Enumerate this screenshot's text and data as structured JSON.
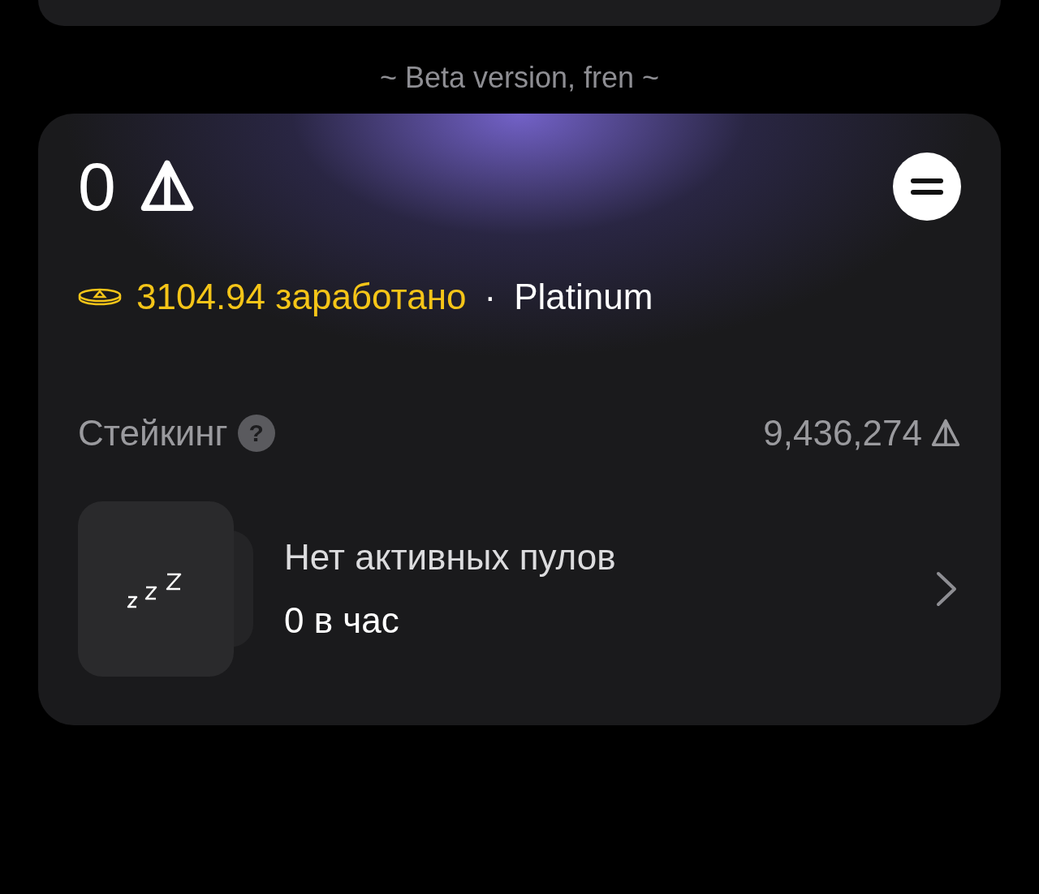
{
  "beta_note": "~ Beta version, fren ~",
  "balance": {
    "amount": "0"
  },
  "earned": {
    "amount": "3104.94 заработано",
    "separator": "·",
    "tier": "Platinum"
  },
  "staking": {
    "label": "Стейкинг",
    "help": "?",
    "total": "9,436,274"
  },
  "pools": {
    "title": "Нет активных пулов",
    "rate": "0 в час"
  }
}
